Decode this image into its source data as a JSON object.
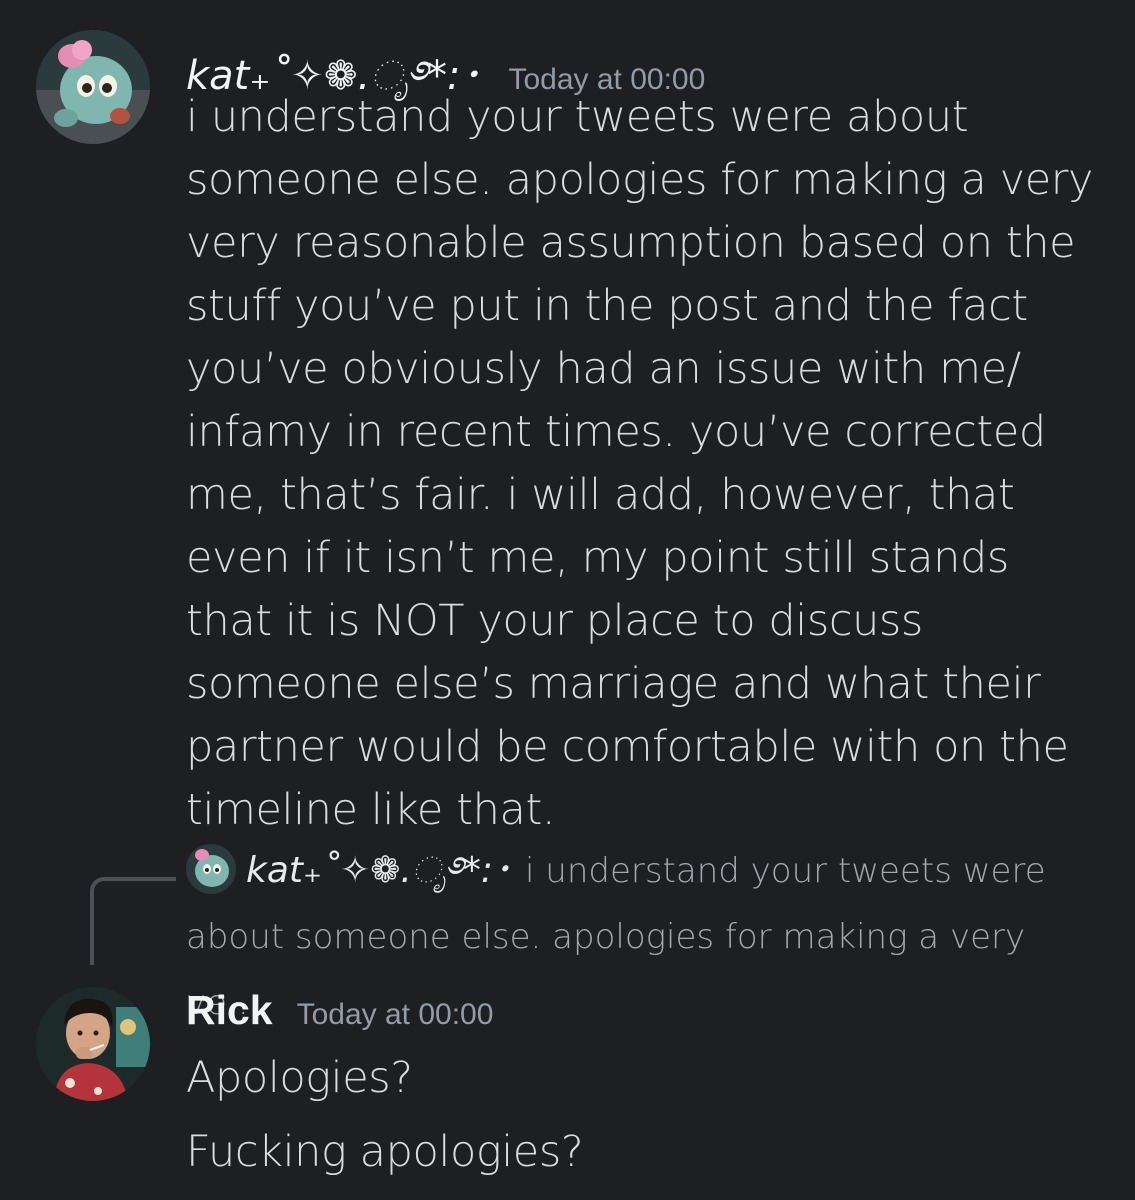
{
  "messages": [
    {
      "username": "kat₊˚✧❁.ೃ࿔*:･",
      "timestamp": "Today at 00:00",
      "avatar_icon": "teal-cartoon-creature-avatar",
      "text": "i understand your tweets were about someone else. apologies for making a very very reasonable assumption based on the stuff you’ve put in the post and the fact you’ve obviously had an issue with me/ infamy in recent times. you’ve corrected me, that’s fair. i will add, however, that even if it isn’t me, my point still stands that it is NOT your place to discuss someone else’s marriage and what their partner would be comfortable with on the timeline like that."
    },
    {
      "username": "Rick",
      "timestamp": "Today at 00:00",
      "avatar_icon": "person-smoking-photo-avatar",
      "reply_to": {
        "username": "kat₊˚✧❁.ೃ࿔*:･",
        "preview": "i understand your tweets were about someone else. apologies for making a very ve..."
      },
      "lines": [
        "Apologies?",
        "Fucking apologies?"
      ]
    }
  ],
  "colors": {
    "background": "#1e1f23",
    "username": "#f2f3f5",
    "timestamp": "#949ba4",
    "text": "#dadbde",
    "reply_spine": "#4e5058"
  }
}
